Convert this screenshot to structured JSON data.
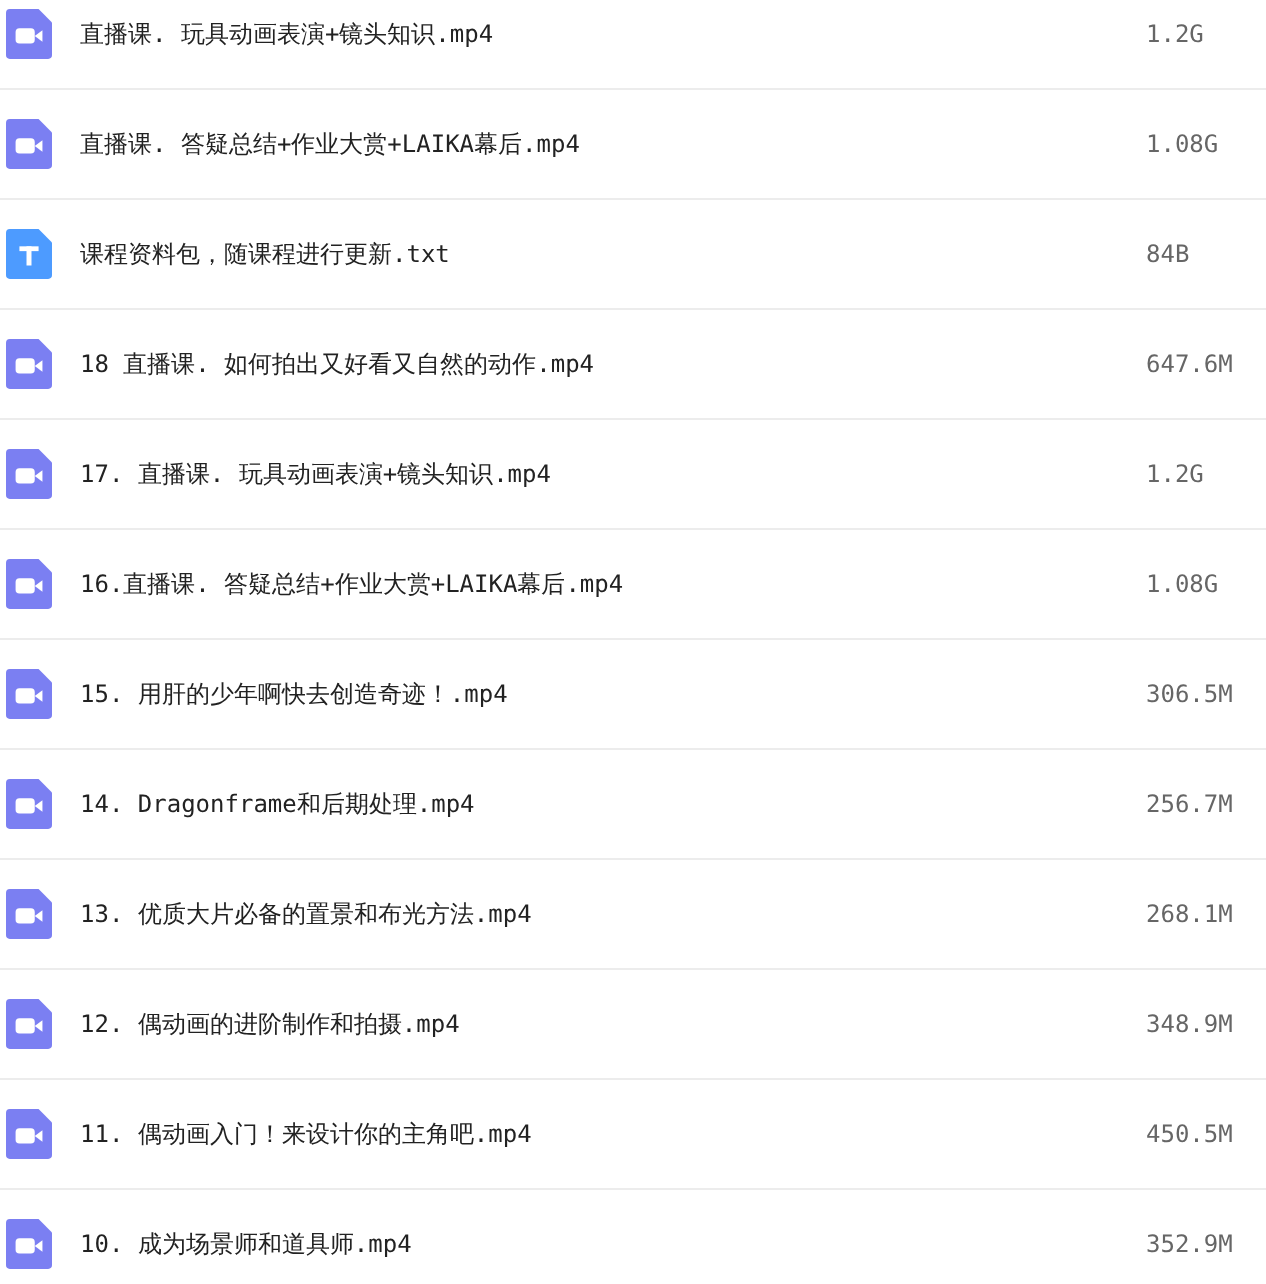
{
  "files": [
    {
      "kind": "video",
      "name": "直播课. 玩具动画表演+镜头知识.mp4",
      "size": "1.2G"
    },
    {
      "kind": "video",
      "name": "直播课. 答疑总结+作业大赏+LAIKA幕后.mp4",
      "size": "1.08G"
    },
    {
      "kind": "text",
      "name": "课程资料包，随课程进行更新.txt",
      "size": "84B"
    },
    {
      "kind": "video",
      "name": "18 直播课. 如何拍出又好看又自然的动作.mp4",
      "size": "647.6M"
    },
    {
      "kind": "video",
      "name": "17. 直播课. 玩具动画表演+镜头知识.mp4",
      "size": "1.2G"
    },
    {
      "kind": "video",
      "name": "16.直播课. 答疑总结+作业大赏+LAIKA幕后.mp4",
      "size": "1.08G"
    },
    {
      "kind": "video",
      "name": "15. 用肝的少年啊快去创造奇迹！.mp4",
      "size": "306.5M"
    },
    {
      "kind": "video",
      "name": "14. Dragonframe和后期处理.mp4",
      "size": "256.7M"
    },
    {
      "kind": "video",
      "name": "13. 优质大片必备的置景和布光方法.mp4",
      "size": "268.1M"
    },
    {
      "kind": "video",
      "name": "12. 偶动画的进阶制作和拍摄.mp4",
      "size": "348.9M"
    },
    {
      "kind": "video",
      "name": "11. 偶动画入门！来设计你的主角吧.mp4",
      "size": "450.5M"
    },
    {
      "kind": "video",
      "name": "10. 成为场景师和道具师.mp4",
      "size": "352.9M"
    }
  ]
}
